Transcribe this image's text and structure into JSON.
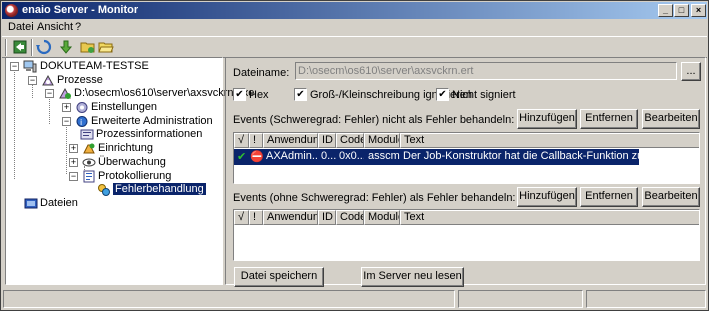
{
  "window": {
    "title": "enaio Server - Monitor"
  },
  "menu": {
    "items": [
      "Datei",
      "Ansicht",
      "?"
    ]
  },
  "toolbar": {
    "icons": [
      "connect-icon",
      "refresh-icon",
      "download-icon",
      "folder-icon",
      "folder-open-icon"
    ]
  },
  "tree": {
    "root": "DOKUTEAM-TESTSE",
    "prozesse": "Prozesse",
    "exe": "D:\\osecm\\os610\\server\\axsvckrn.exe",
    "einstellungen": "Einstellungen",
    "erweiterte": "Erweiterte Administration",
    "prozessinfo": "Prozessinformationen",
    "einrichtung": "Einrichtung",
    "ueberwachung": "Überwachung",
    "protokollierung": "Protokollierung",
    "fehlerbehandlung": "Fehlerbehandlung",
    "dateien": "Dateien"
  },
  "detail": {
    "dateiname_label": "Dateiname:",
    "dateiname_value": "D:\\osecm\\os610\\server\\axsvckrn.ert",
    "browse_label": "...",
    "hex_label": "Hex",
    "hex_checked": "✔",
    "gross_label": "Groß-/Kleinschreibung ignorieren",
    "gross_checked": "✔",
    "nicht_label": "Nicht signiert",
    "nicht_checked": "✔",
    "events1_label": "Events (Schweregrad: Fehler) nicht als Fehler behandeln:",
    "events2_label": "Events (ohne Schweregrad: Fehler) als Fehler behandeln:",
    "btn_add": "Hinzufügen",
    "btn_remove": "Entfernen",
    "btn_edit": "Bearbeiten",
    "btn_save": "Datei speichern",
    "btn_reload": "Im Server neu lesen"
  },
  "table": {
    "columns": [
      "√",
      "!",
      "Anwendung",
      "ID",
      "Code",
      "Module",
      "Text"
    ],
    "rows": [
      {
        "check": "✔",
        "severity": "⛔",
        "anwendung": "AXAdmin....",
        "id": "0...",
        "code": "0x0...",
        "module": "asscmn",
        "text": "Der Job-Konstruktor hat die Callback-Funktion zum Absende..."
      }
    ]
  },
  "colors": {
    "selection": "#0a246a",
    "title_start": "#0a246a",
    "title_end": "#a6caf0",
    "face": "#d4d0c8"
  }
}
